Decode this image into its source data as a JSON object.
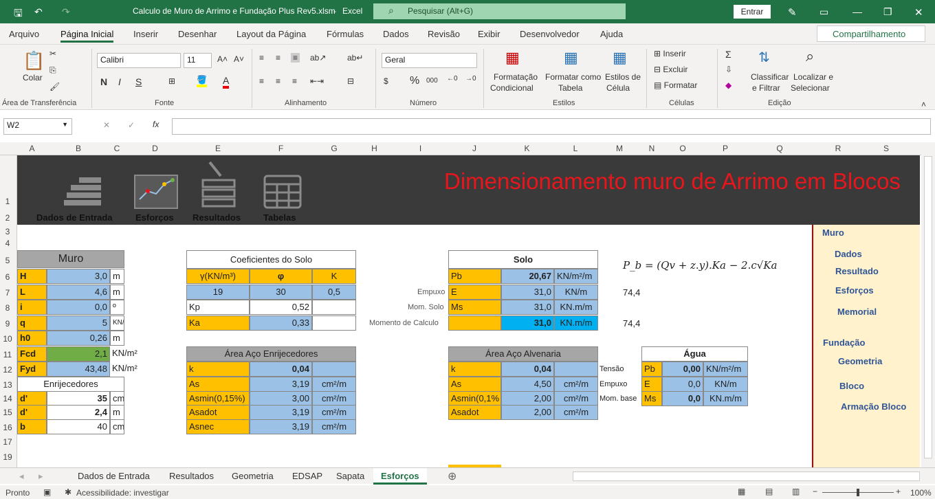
{
  "titlebar": {
    "filename": "Calculo de Muro de Arrimo e Fundação Plus Rev5.xlsm",
    "sep": "-",
    "app": "Excel",
    "search_placeholder": "Pesquisar (Alt+G)",
    "signin": "Entrar"
  },
  "menu": {
    "items": [
      "Arquivo",
      "Página Inicial",
      "Inserir",
      "Desenhar",
      "Layout da Página",
      "Fórmulas",
      "Dados",
      "Revisão",
      "Exibir",
      "Desenvolvedor",
      "Ajuda"
    ],
    "share": "Compartilhamento"
  },
  "ribbon": {
    "paste": "Colar",
    "clipboard": "Área de Transferência",
    "font_name": "Calibri",
    "font_size": "11",
    "bold": "N",
    "italic": "I",
    "underline": "S",
    "font_group": "Fonte",
    "align_group": "Alinhamento",
    "number_format": "Geral",
    "number_group": "Número",
    "cond_fmt": "Formatação",
    "cond_fmt2": "Condicional",
    "fmt_table": "Formatar como",
    "fmt_table2": "Tabela",
    "cell_styles": "Estilos de",
    "cell_styles2": "Célula",
    "styles_group": "Estilos",
    "insert": "Inserir",
    "delete": "Excluir",
    "format": "Formatar",
    "cells_group": "Células",
    "sort": "Classificar",
    "sort2": "e Filtrar",
    "find": "Localizar e",
    "find2": "Selecionar",
    "edit_group": "Edição"
  },
  "formula": {
    "namebox": "W2",
    "fx": "fx"
  },
  "columns": [
    "A",
    "B",
    "C",
    "D",
    "E",
    "F",
    "G",
    "H",
    "I",
    "J",
    "K",
    "L",
    "M",
    "N",
    "O",
    "P",
    "Q",
    "R",
    "S"
  ],
  "rows": [
    "1",
    "2",
    "3",
    "4",
    "5",
    "6",
    "7",
    "8",
    "9",
    "10",
    "11",
    "12",
    "13",
    "14",
    "15",
    "16",
    "17",
    "19"
  ],
  "banner": {
    "title": "Dimensionamento muro de Arrimo em Blocos",
    "nav": [
      "Dados de Entrada",
      "Esforços",
      "Resultados",
      "Tabelas"
    ]
  },
  "muro": {
    "title": "Muro",
    "rows": [
      [
        "H",
        "3,0",
        "m"
      ],
      [
        "L",
        "4,6",
        "m"
      ],
      [
        "i",
        "0,0",
        "º"
      ],
      [
        "q",
        "5",
        "KN/m"
      ],
      [
        "h0",
        "0,26",
        "m"
      ],
      [
        "Fcd",
        "2,1",
        "KN/m²"
      ],
      [
        "Fyd",
        "43,48",
        "KN/m²"
      ]
    ]
  },
  "enrij": {
    "title": "Enrijecedores",
    "rows": [
      [
        "d'",
        "35",
        "cm"
      ],
      [
        "d'",
        "2,4",
        "m"
      ],
      [
        "b",
        "40",
        "cm"
      ]
    ]
  },
  "coef": {
    "title": "Coeficientes  do Solo",
    "headers": [
      "γ(KN/m³)",
      "φ",
      "K"
    ],
    "values": [
      "19",
      "30",
      "0,5"
    ],
    "kp_label": "Kp",
    "kp": "0,52",
    "ka_label": "Ka",
    "ka": "0,33"
  },
  "area_enrij": {
    "title": "Área Aço Enrijecedores",
    "rows": [
      [
        "k",
        "0,04",
        ""
      ],
      [
        "As",
        "3,19",
        "cm²/m"
      ],
      [
        "Asmin(0,15%)",
        "3,00",
        "cm²/m"
      ],
      [
        "Asadot",
        "3,19",
        "cm²/m"
      ],
      [
        "Asnec",
        "3,19",
        "cm²/m"
      ]
    ]
  },
  "solo": {
    "title": "Solo",
    "side_labels": [
      "Empuxo",
      "Mom. Solo",
      "Momento de Calculo"
    ],
    "rows": [
      [
        "Pb",
        "20,67",
        "KN/m²/m"
      ],
      [
        "E",
        "31,0",
        "KN/m"
      ],
      [
        "Ms",
        "31,0",
        "KN.m/m"
      ],
      [
        "",
        "31,0",
        "KN.m/m"
      ]
    ],
    "extra1": "74,4",
    "extra2": "74,4"
  },
  "formula_text": "P_b = (Qv + z.y).Ka − 2.c√Ka",
  "area_alv": {
    "title": "Área Aço Alvenaria",
    "rows": [
      [
        "k",
        "0,04",
        ""
      ],
      [
        "As",
        "4,50",
        "cm²/m"
      ],
      [
        "Asmin(0,1%",
        "2,00",
        "cm²/m"
      ],
      [
        "Asadot",
        "2,00",
        "cm²/m"
      ]
    ],
    "side_labels": [
      "Tensão",
      "Empuxo",
      "Mom. base"
    ]
  },
  "agua": {
    "title": "Água",
    "rows": [
      [
        "Pb",
        "0,00",
        "KN/m²/m"
      ],
      [
        "E",
        "0,0",
        "KN/m"
      ],
      [
        "Ms",
        "0,0",
        "KN.m/m"
      ]
    ]
  },
  "sidebar": {
    "items": [
      "Muro",
      "Dados",
      "Resultado",
      "Esforços",
      "Memorial",
      "Fundação",
      "Geometria",
      "Bloco",
      "Armação Bloco"
    ]
  },
  "tabs": {
    "items": [
      "Dados de Entrada",
      "Resultados",
      "Geometria",
      "EDSAP",
      "Sapata",
      "Esforços"
    ]
  },
  "status": {
    "ready": "Pronto",
    "access": "Acessibilidade: investigar",
    "zoom": "100%"
  },
  "colors": {
    "excel_green": "#217346",
    "orange": "#ffc000",
    "blue": "#9bc2e6",
    "banner": "#3a3a3a",
    "title_red": "#e8161c"
  }
}
